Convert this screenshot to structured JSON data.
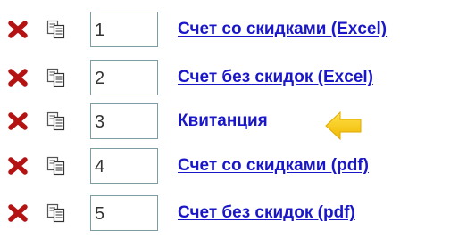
{
  "rows": [
    {
      "number": "1",
      "link": "Счет со скидками (Excel)",
      "pointer": false
    },
    {
      "number": "2",
      "link": "Счет без скидок (Excel)",
      "pointer": false
    },
    {
      "number": "3",
      "link": "Квитанция",
      "pointer": true
    },
    {
      "number": "4",
      "link": "Счет со скидками (pdf)",
      "pointer": false
    },
    {
      "number": "5",
      "link": "Счет без скидок (pdf)",
      "pointer": false
    }
  ],
  "icons": {
    "delete": "close-icon",
    "copy": "copy-icon",
    "pointer": "arrow-left-icon"
  },
  "colors": {
    "link": "#1a17c8",
    "delete": "#b31313",
    "pointer": "#f6c60c",
    "field_border": "#7a9ea1"
  }
}
